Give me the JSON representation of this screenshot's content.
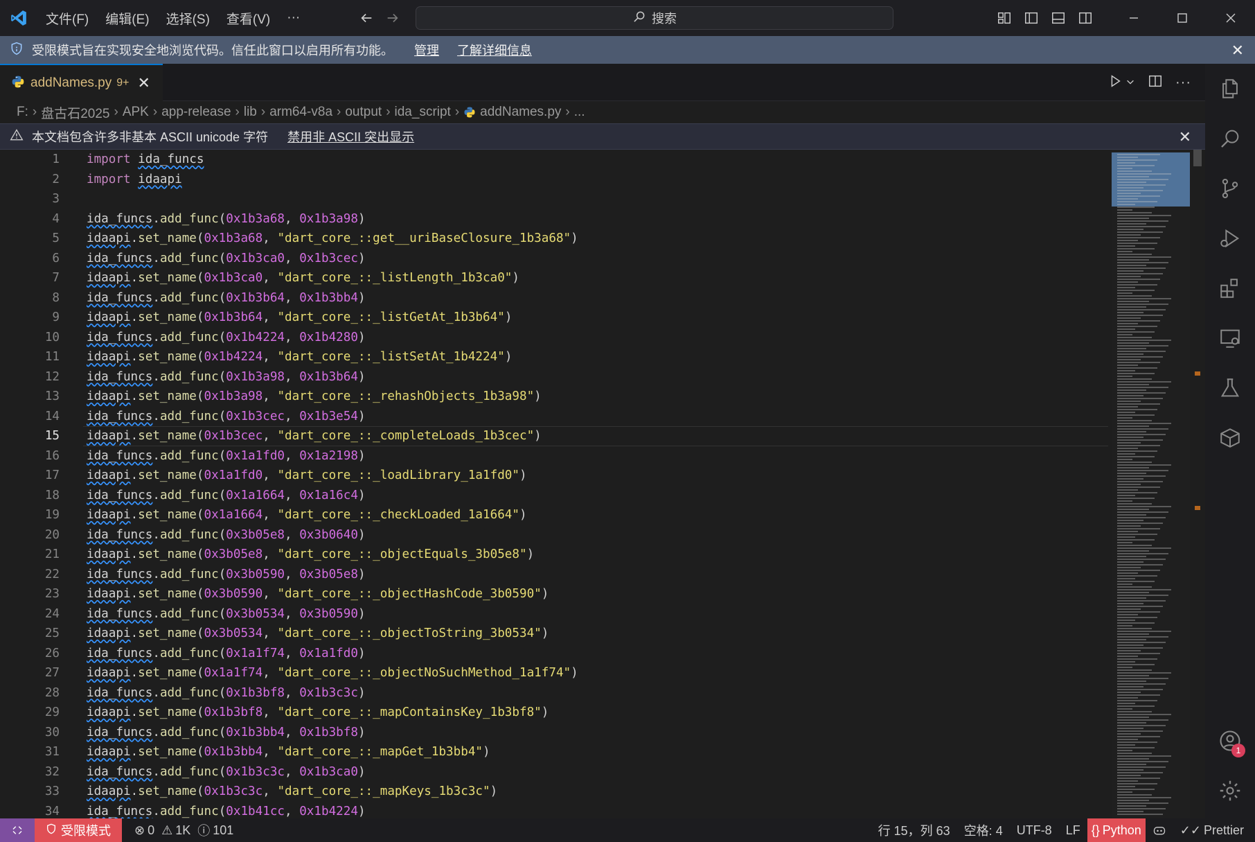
{
  "titlebar": {
    "menus": [
      "文件(F)",
      "编辑(E)",
      "选择(S)",
      "查看(V)",
      "···"
    ],
    "search_placeholder": "搜索"
  },
  "restricted_banner": {
    "message": "受限模式旨在实现安全地浏览代码。信任此窗口以启用所有功能。",
    "manage": "管理",
    "learn_more": "了解详细信息"
  },
  "tab": {
    "filename": "addNames.py",
    "badge": "9+"
  },
  "breadcrumb": [
    "F:",
    "盘古石2025",
    "APK",
    "app-release",
    "lib",
    "arm64-v8a",
    "output",
    "ida_script",
    "addNames.py",
    "..."
  ],
  "ascii_banner": {
    "message": "本文档包含许多非基本 ASCII unicode 字符",
    "disable": "禁用非 ASCII 突出显示"
  },
  "code_lines": [
    "import ida_funcs",
    "import idaapi",
    "",
    "ida_funcs.add_func(0x1b3a68, 0x1b3a98)",
    "idaapi.set_name(0x1b3a68, \"dart_core_::get__uriBaseClosure_1b3a68\")",
    "ida_funcs.add_func(0x1b3ca0, 0x1b3cec)",
    "idaapi.set_name(0x1b3ca0, \"dart_core_::_listLength_1b3ca0\")",
    "ida_funcs.add_func(0x1b3b64, 0x1b3bb4)",
    "idaapi.set_name(0x1b3b64, \"dart_core_::_listGetAt_1b3b64\")",
    "ida_funcs.add_func(0x1b4224, 0x1b4280)",
    "idaapi.set_name(0x1b4224, \"dart_core_::_listSetAt_1b4224\")",
    "ida_funcs.add_func(0x1b3a98, 0x1b3b64)",
    "idaapi.set_name(0x1b3a98, \"dart_core_::_rehashObjects_1b3a98\")",
    "ida_funcs.add_func(0x1b3cec, 0x1b3e54)",
    "idaapi.set_name(0x1b3cec, \"dart_core_::_completeLoads_1b3cec\")",
    "ida_funcs.add_func(0x1a1fd0, 0x1a2198)",
    "idaapi.set_name(0x1a1fd0, \"dart_core_::_loadLibrary_1a1fd0\")",
    "ida_funcs.add_func(0x1a1664, 0x1a16c4)",
    "idaapi.set_name(0x1a1664, \"dart_core_::_checkLoaded_1a1664\")",
    "ida_funcs.add_func(0x3b05e8, 0x3b0640)",
    "idaapi.set_name(0x3b05e8, \"dart_core_::_objectEquals_3b05e8\")",
    "ida_funcs.add_func(0x3b0590, 0x3b05e8)",
    "idaapi.set_name(0x3b0590, \"dart_core_::_objectHashCode_3b0590\")",
    "ida_funcs.add_func(0x3b0534, 0x3b0590)",
    "idaapi.set_name(0x3b0534, \"dart_core_::_objectToString_3b0534\")",
    "ida_funcs.add_func(0x1a1f74, 0x1a1fd0)",
    "idaapi.set_name(0x1a1f74, \"dart_core_::_objectNoSuchMethod_1a1f74\")",
    "ida_funcs.add_func(0x1b3bf8, 0x1b3c3c)",
    "idaapi.set_name(0x1b3bf8, \"dart_core_::_mapContainsKey_1b3bf8\")",
    "ida_funcs.add_func(0x1b3bb4, 0x1b3bf8)",
    "idaapi.set_name(0x1b3bb4, \"dart_core_::_mapGet_1b3bb4\")",
    "ida_funcs.add_func(0x1b3c3c, 0x1b3ca0)",
    "idaapi.set_name(0x1b3c3c, \"dart_core_::_mapKeys_1b3c3c\")",
    "ida_funcs.add_func(0x1b41cc, 0x1b4224)"
  ],
  "current_line": 15,
  "statusbar": {
    "restricted": "受限模式",
    "errors": "0",
    "warnings": "1K",
    "infos": "101",
    "position": "行 15，列 63",
    "spaces": "空格: 4",
    "encoding": "UTF-8",
    "eol": "LF",
    "language": "Python",
    "formatter": "Prettier"
  },
  "colors": {
    "accent": "#0078d4",
    "restricted": "#e04e55",
    "remote": "#7d4e9f",
    "banner": "#4d5a70"
  }
}
